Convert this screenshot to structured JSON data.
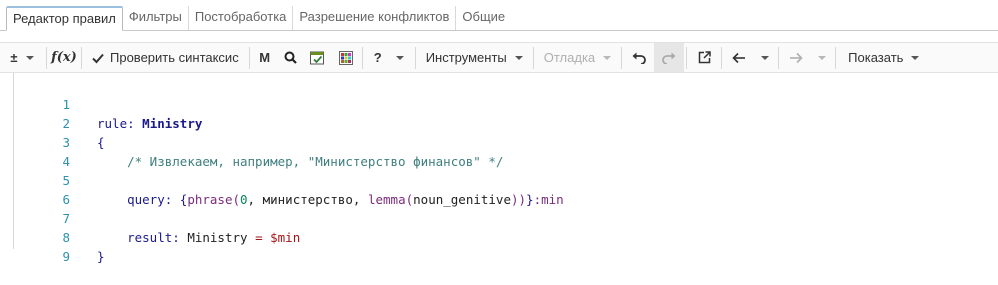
{
  "tabs": [
    {
      "label": "Редактор правил",
      "active": true
    },
    {
      "label": "Фильтры"
    },
    {
      "label": "Постобработка"
    },
    {
      "label": "Разрешение конфликтов"
    },
    {
      "label": "Общие"
    }
  ],
  "toolbar": {
    "plusminus_label": "±",
    "fx_label": "f(x)",
    "check_syntax_label": "Проверить синтаксис",
    "m_label": "M",
    "help_label": "?",
    "tools_label": "Инструменты",
    "debug_label": "Отладка",
    "show_label": "Показать"
  },
  "editor": {
    "line_numbers": [
      "1",
      "2",
      "3",
      "4",
      "5",
      "6",
      "7",
      "8",
      "9"
    ],
    "lines": {
      "l1_kw": "rule:",
      "l1_name": "Ministry",
      "l2_brace": "{",
      "l3_comment": "/* Извлекаем, например, \"Министерство финансов\" */",
      "l5_kw": "query:",
      "l5_brace_open": "{",
      "l5_fn": "phrase",
      "l5_paren_open": "(",
      "l5_num": "0",
      "l5_comma1": ", министерство, ",
      "l5_fn2": "lemma",
      "l5_paren2_open": "(",
      "l5_arg": "noun_genitive",
      "l5_close": "))",
      "l5_brace_close": "}",
      "l5_suffix": ":min",
      "l7_kw": "result:",
      "l7_name": "Ministry",
      "l7_eq": " = ",
      "l7_var": "$min",
      "l8_brace": "}"
    }
  }
}
